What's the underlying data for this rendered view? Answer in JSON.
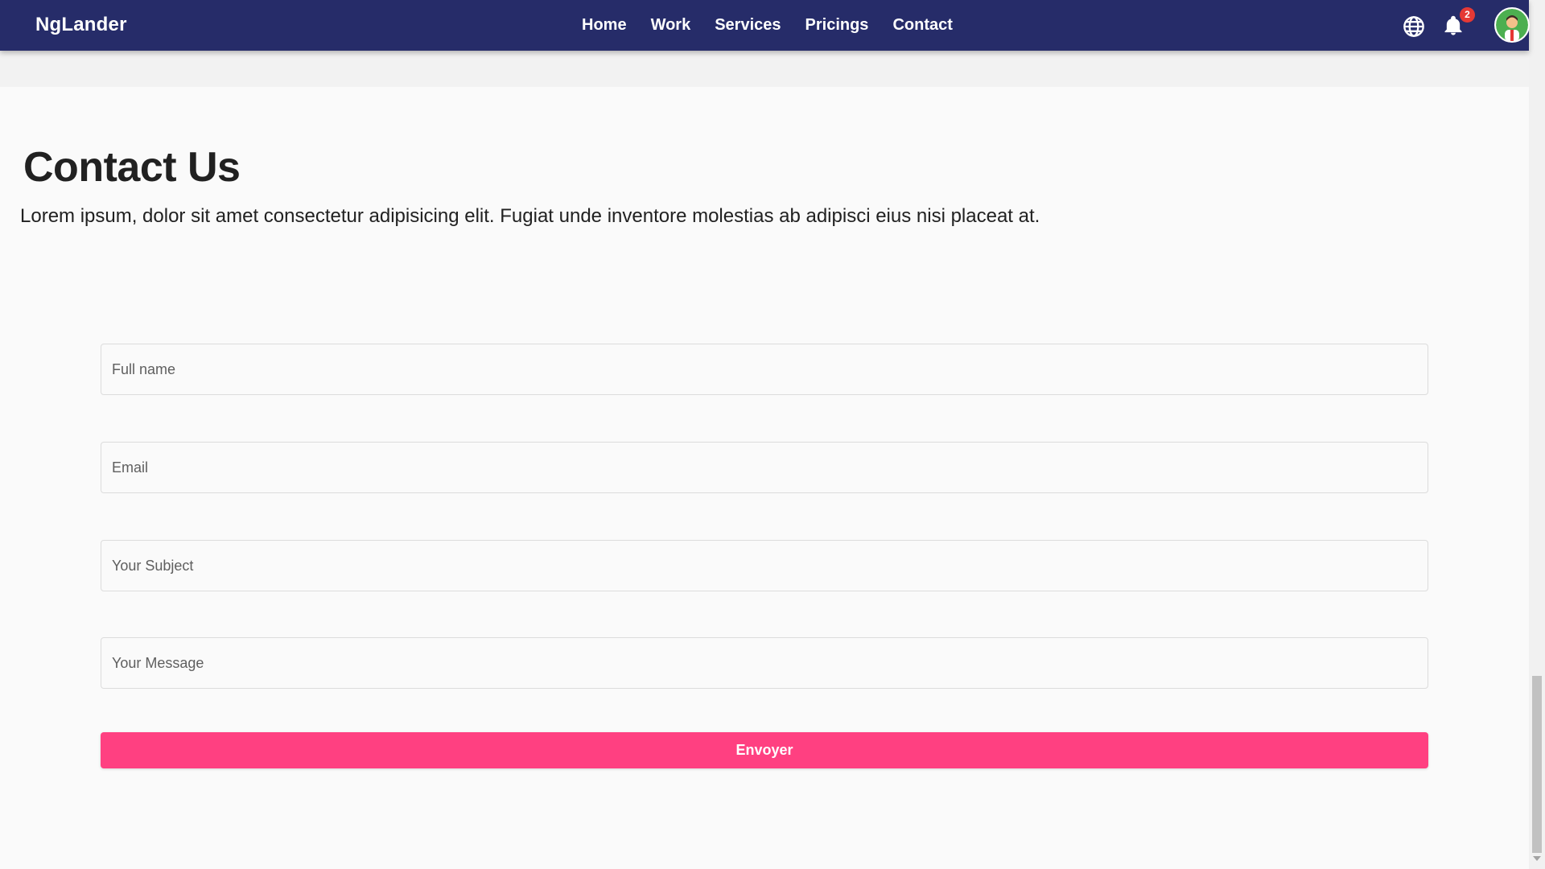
{
  "header": {
    "brand": "NgLander",
    "nav": [
      {
        "label": "Home"
      },
      {
        "label": "Work"
      },
      {
        "label": "Services"
      },
      {
        "label": "Pricings"
      },
      {
        "label": "Contact"
      }
    ],
    "icons": [
      "globe-icon",
      "bell-icon",
      "avatar"
    ],
    "notification_count": "2"
  },
  "contact": {
    "title": "Contact Us",
    "description": "Lorem ipsum, dolor sit amet consectetur adipisicing elit. Fugiat unde inventore molestias ab adipisci eius nisi placeat at."
  },
  "form": {
    "full_name_placeholder": "Full name",
    "email_placeholder": "Email",
    "subject_placeholder": "Your Subject",
    "message_placeholder": "Your Message",
    "submit_label": "Envoyer"
  },
  "colors": {
    "toolbar": "#262c69",
    "accent": "#ff4081",
    "badge": "#e53935"
  }
}
